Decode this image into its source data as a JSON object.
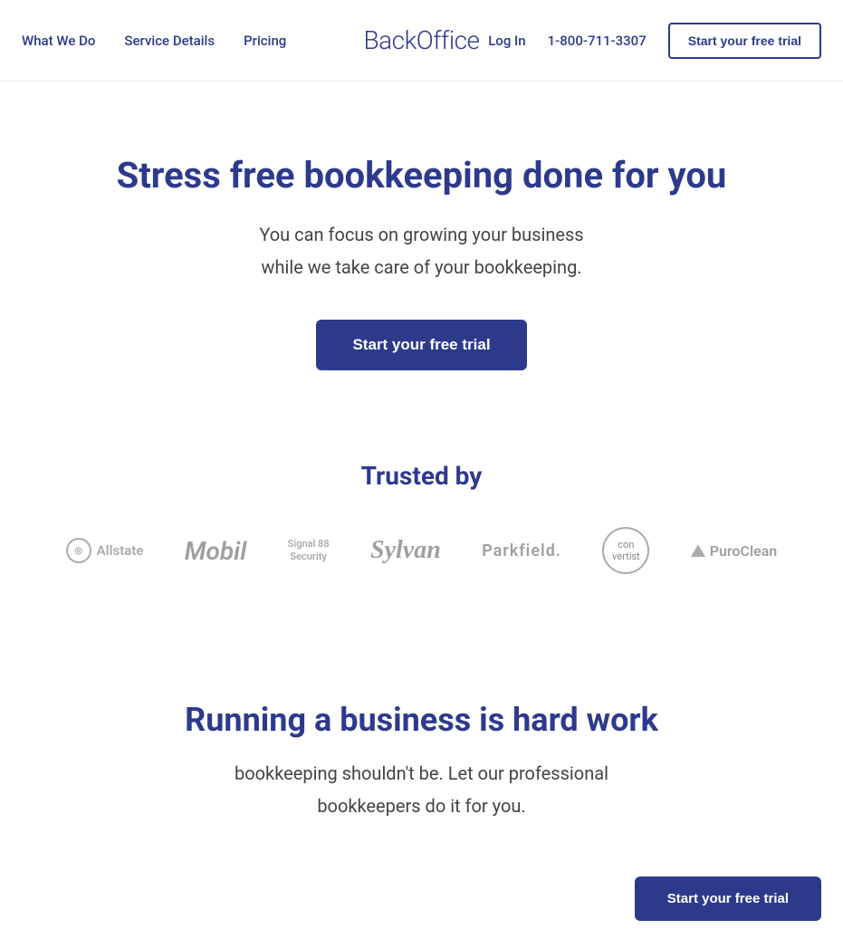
{
  "nav": {
    "link1": "What We Do",
    "link2": "Service Details",
    "link3": "Pricing",
    "logo": "BackOffice",
    "login": "Log In",
    "phone": "1-800-711-3307",
    "cta": "Start your free trial"
  },
  "hero": {
    "title": "Stress free bookkeeping done for you",
    "subtitle_line1": "You can focus on growing your business",
    "subtitle_line2": "while we take care of your bookkeeping.",
    "cta": "Start your free trial"
  },
  "trusted": {
    "title": "Trusted by",
    "logos": [
      {
        "name": "Allstate",
        "type": "allstate"
      },
      {
        "name": "Mobil",
        "type": "mobil"
      },
      {
        "name": "Signal 88 Security",
        "type": "signal"
      },
      {
        "name": "Sylvan Learning",
        "type": "sylvan"
      },
      {
        "name": "Parkfield.",
        "type": "parkfield"
      },
      {
        "name": "Convertist",
        "type": "convertist"
      },
      {
        "name": "PuroClean",
        "type": "puroclean"
      }
    ]
  },
  "hardwork": {
    "title": "Running a business is hard work",
    "subtitle": "bookkeeping shouldn't be. Let our professional bookkeepers do it for you."
  },
  "bottom": {
    "cta": "Start your free trial"
  },
  "colors": {
    "brand_blue": "#2d3a8c"
  }
}
